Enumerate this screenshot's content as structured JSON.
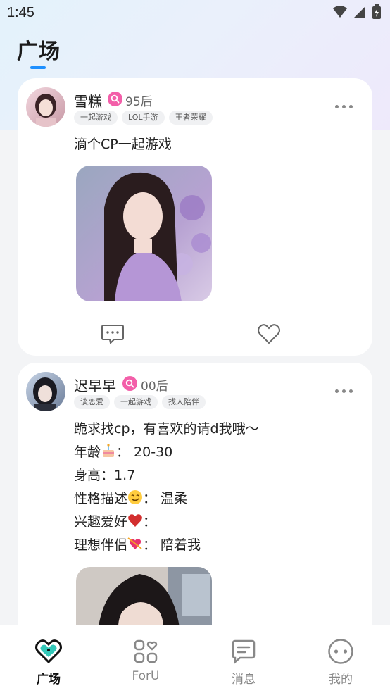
{
  "status_bar": {
    "time": "1:45"
  },
  "header": {
    "title": "广场"
  },
  "posts": [
    {
      "name": "雪糕",
      "age": "95后",
      "tags": [
        "一起游戏",
        "LOL手游",
        "王者荣耀"
      ],
      "lines": [
        "滴个CP一起游戏"
      ]
    },
    {
      "name": "迟早早",
      "age": "00后",
      "tags": [
        "谈恋爱",
        "一起游戏",
        "找人陪伴"
      ],
      "lines": [
        "跪求找cp，有喜欢的请d我哦～",
        "年龄",
        "：  20-30",
        "身高：1.7",
        "性格描述",
        "：  温柔",
        "兴趣爱好",
        "：",
        "理想伴侣",
        "：  陪着我"
      ]
    }
  ],
  "tabbar": {
    "items": [
      {
        "label": "广场",
        "icon": "heart-chat-icon",
        "active": true
      },
      {
        "label": "ForU",
        "icon": "grid-heart-icon",
        "active": false
      },
      {
        "label": "消息",
        "icon": "message-icon",
        "active": false
      },
      {
        "label": "我的",
        "icon": "face-icon",
        "active": false
      }
    ]
  },
  "colors": {
    "accent": "#1e90ff",
    "age_badge": "#f35fa9",
    "like_heart": "#d32f2f"
  }
}
